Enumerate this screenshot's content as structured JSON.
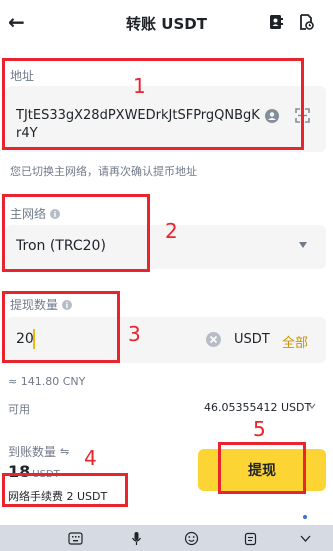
{
  "header": {
    "back_icon": "arrow-left-icon",
    "title": "转账 USDT",
    "icons": [
      "address-book-icon",
      "history-icon"
    ]
  },
  "address": {
    "label": "地址",
    "value": "TJtES33gX28dPXWEDrkJtSFPrgQNBgKr4Y",
    "hint": "您已切换主网络，请再次确认提币地址",
    "icons": [
      "user-icon",
      "scan-icon"
    ]
  },
  "network": {
    "label": "主网络",
    "value": "Tron (TRC20)",
    "icons": [
      "info-icon",
      "caret-down-icon"
    ]
  },
  "amount": {
    "label": "提现数量",
    "value": "20",
    "unit": "USDT",
    "all_label": "全部",
    "cny_equiv": "≈ 141.80 CNY",
    "icons": [
      "info-icon",
      "clear-icon"
    ]
  },
  "available": {
    "label": "可用",
    "value": "46.05355412 USDT"
  },
  "receive": {
    "label": "到账数量",
    "value": "18",
    "unit": "USDT",
    "fee_label": "网络手续费 2 USDT",
    "icons": [
      "swap-icon"
    ]
  },
  "submit_label": "提现",
  "annotations": [
    "1",
    "2",
    "3",
    "4",
    "5"
  ],
  "colors": {
    "accent": "#fcd535",
    "accent_text": "#c99400",
    "annotation": "#e8242c",
    "field_bg": "#f5f5f5"
  },
  "keyboard": {
    "icons": [
      "keyboard-grid-icon",
      "microphone-icon",
      "emoji-icon",
      "clipboard-icon",
      "chevron-down-icon"
    ]
  }
}
